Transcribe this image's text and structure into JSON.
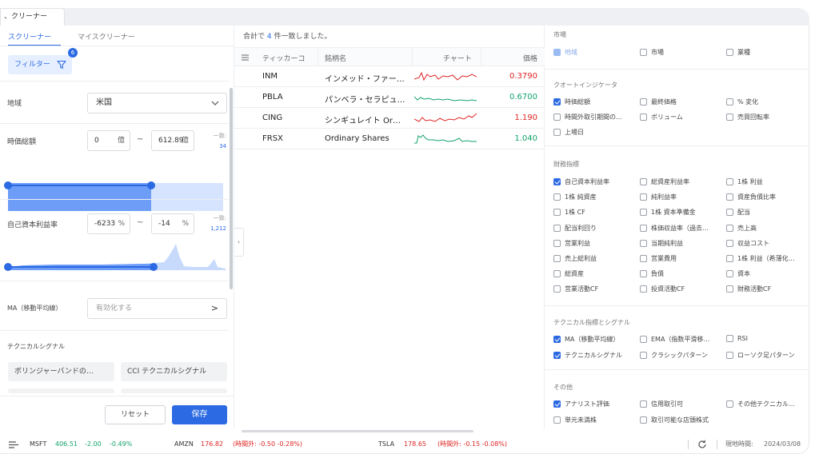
{
  "app": {
    "tab_title": "、クリーナー"
  },
  "left": {
    "tabs": [
      "スクリーナー",
      "マイスクリーナー"
    ],
    "filter_label": "フィルター",
    "filter_count": "6",
    "region": {
      "label": "地域",
      "value": "米国"
    },
    "market_cap": {
      "label": "時価総額",
      "min": "0",
      "max": "612.89",
      "unit": "億",
      "match_label": "一致:",
      "match_count": "34"
    },
    "roe": {
      "label": "自己資本利益率",
      "min": "-6233",
      "max": "-14",
      "unit": "%",
      "match_label": "一致:",
      "match_count": "1,212"
    },
    "ma": {
      "label": "MA（移動平均線）",
      "placeholder": "有効化する",
      "arrow": ">"
    },
    "tech_signal_label": "テクニカルシグナル",
    "chips": [
      "ボリンジャーバンドの…",
      "CCI テクニカルシグナル"
    ],
    "buttons": {
      "reset": "リセット",
      "save": "保存"
    }
  },
  "middle": {
    "summary_prefix": "合計で",
    "summary_count": "4",
    "summary_suffix": "件一致しました。",
    "columns": [
      "ティッカーコ",
      "銘柄名",
      "チャート",
      "価格"
    ],
    "rows": [
      {
        "ticker": "INM",
        "name": "インメッド・ファー…",
        "price": "0.3790",
        "trend": "up",
        "spark_color": "#e02424"
      },
      {
        "ticker": "PBLA",
        "name": "パンベラ・セラピュ…",
        "price": "0.6700",
        "trend": "down",
        "spark_color": "#13a36b"
      },
      {
        "ticker": "CING",
        "name": "シンギュレイト Or…",
        "price": "1.190",
        "trend": "up",
        "spark_color": "#e02424"
      },
      {
        "ticker": "FRSX",
        "name": "Ordinary Shares",
        "price": "1.040",
        "trend": "down",
        "spark_color": "#13a36b"
      }
    ],
    "collapse_arrow": "‹"
  },
  "right": {
    "sections": [
      {
        "title": "市場",
        "items": [
          {
            "label": "地域",
            "state": "disabled"
          },
          {
            "label": "市場",
            "state": "off"
          },
          {
            "label": "業種",
            "state": "off"
          }
        ]
      },
      {
        "title": "クオートインジケータ",
        "items": [
          {
            "label": "時価総額",
            "state": "on"
          },
          {
            "label": "最終価格",
            "state": "off"
          },
          {
            "label": "% 変化",
            "state": "off"
          },
          {
            "label": "時間外取引期間の…",
            "state": "off"
          },
          {
            "label": "ボリューム",
            "state": "off"
          },
          {
            "label": "売買回転率",
            "state": "off"
          },
          {
            "label": "上場日",
            "state": "off"
          }
        ]
      },
      {
        "title": "財務指標",
        "items": [
          {
            "label": "自己資本利益率",
            "state": "on"
          },
          {
            "label": "総資産利益率",
            "state": "off"
          },
          {
            "label": "1株 利益",
            "state": "off"
          },
          {
            "label": "1株 純資産",
            "state": "off"
          },
          {
            "label": "純利益率",
            "state": "off"
          },
          {
            "label": "資産負債比率",
            "state": "off"
          },
          {
            "label": "1株 CF",
            "state": "off"
          },
          {
            "label": "1株 資本準備金",
            "state": "off"
          },
          {
            "label": "配当",
            "state": "off"
          },
          {
            "label": "配当利回り",
            "state": "off"
          },
          {
            "label": "株価収益率（過去…",
            "state": "off"
          },
          {
            "label": "売上高",
            "state": "off"
          },
          {
            "label": "営業利益",
            "state": "off"
          },
          {
            "label": "当期純利益",
            "state": "off"
          },
          {
            "label": "収益コスト",
            "state": "off"
          },
          {
            "label": "売上総利益",
            "state": "off"
          },
          {
            "label": "営業費用",
            "state": "off"
          },
          {
            "label": "1株 利益（希薄化…",
            "state": "off"
          },
          {
            "label": "総資産",
            "state": "off"
          },
          {
            "label": "負債",
            "state": "off"
          },
          {
            "label": "資本",
            "state": "off"
          },
          {
            "label": "営業活動CF",
            "state": "off"
          },
          {
            "label": "投資活動CF",
            "state": "off"
          },
          {
            "label": "財務活動CF",
            "state": "off"
          }
        ]
      },
      {
        "title": "テクニカル指標とシグナル",
        "items": [
          {
            "label": "MA（移動平均線）",
            "state": "on"
          },
          {
            "label": "EMA（指数平滑移…",
            "state": "off"
          },
          {
            "label": "RSI",
            "state": "off"
          },
          {
            "label": "テクニカルシグナル",
            "state": "on"
          },
          {
            "label": "クラシックパターン",
            "state": "off"
          },
          {
            "label": "ローソク足パターン",
            "state": "off"
          }
        ]
      },
      {
        "title": "その他",
        "items": [
          {
            "label": "アナリスト評価",
            "state": "on"
          },
          {
            "label": "信用取引可",
            "state": "off"
          },
          {
            "label": "その他テクニカル…",
            "state": "off"
          },
          {
            "label": "単元未満株",
            "state": "off"
          },
          {
            "label": "取引可能な店頭株式",
            "state": "off"
          }
        ]
      }
    ]
  },
  "status": {
    "tickers": [
      {
        "symbol": "MSFT",
        "price": "406.51",
        "change": "-2.00",
        "pct": "-0.49%",
        "color": "#13a36b"
      },
      {
        "symbol": "AMZN",
        "price": "176.82",
        "extra": "(時間外: -0.50 -0.28%)",
        "color": "#e02424"
      },
      {
        "symbol": "TSLA",
        "price": "178.65",
        "extra": "(時間外: -0.15 -0.08%)",
        "color": "#e02424"
      }
    ],
    "local_time_label": "現地時間:",
    "local_time": "2024/03/08"
  }
}
